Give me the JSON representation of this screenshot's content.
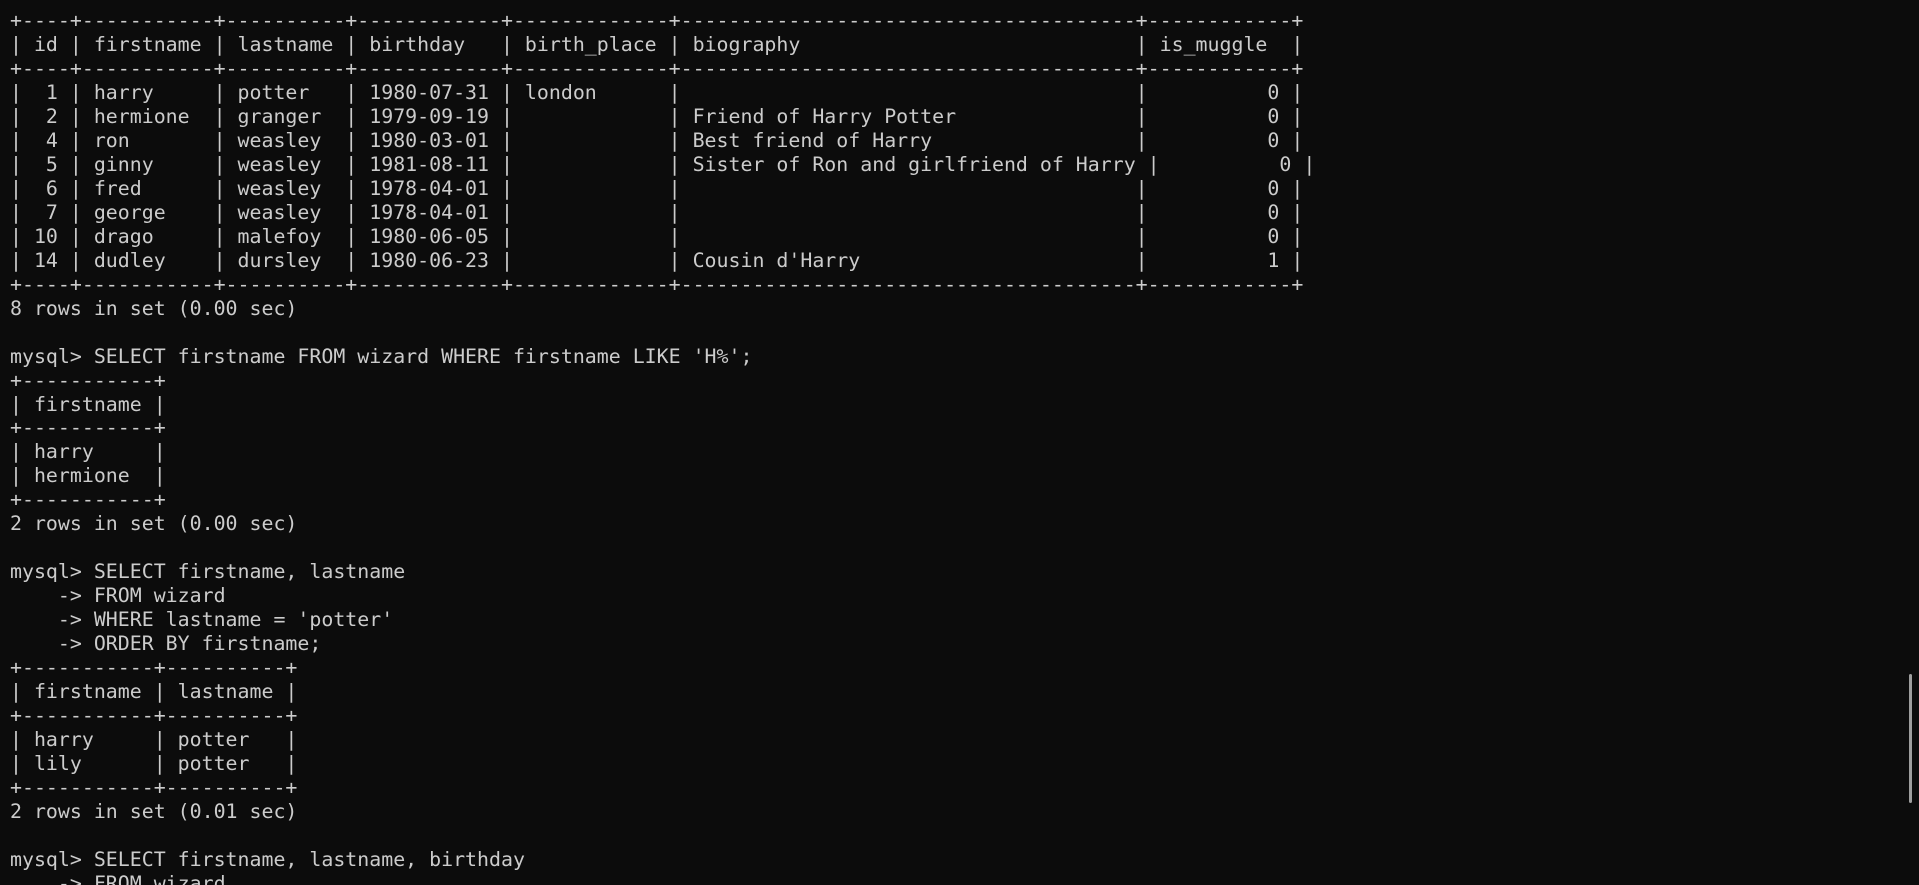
{
  "terminal": {
    "lines": [
      "+----+-----------+----------+------------+-------------+--------------------------------------+------------+",
      "| id | firstname | lastname | birthday   | birth_place | biography                            | is_muggle  |",
      "+----+-----------+----------+------------+-------------+--------------------------------------+------------+",
      "|  1 | harry     | potter   | 1980-07-31 | london      |                                      |          0 |",
      "|  2 | hermione  | granger  | 1979-09-19 |             | Friend of Harry Potter               |          0 |",
      "|  4 | ron       | weasley  | 1980-03-01 |             | Best friend of Harry                 |          0 |",
      "|  5 | ginny     | weasley  | 1981-08-11 |             | Sister of Ron and girlfriend of Harry |          0 |",
      "|  6 | fred      | weasley  | 1978-04-01 |             |                                      |          0 |",
      "|  7 | george    | weasley  | 1978-04-01 |             |                                      |          0 |",
      "| 10 | drago     | malefoy  | 1980-06-05 |             |                                      |          0 |",
      "| 14 | dudley    | dursley  | 1980-06-23 |             | Cousin d'Harry                       |          1 |",
      "+----+-----------+----------+------------+-------------+--------------------------------------+------------+",
      "8 rows in set (0.00 sec)",
      "",
      "mysql> SELECT firstname FROM wizard WHERE firstname LIKE 'H%';",
      "+-----------+",
      "| firstname |",
      "+-----------+",
      "| harry     |",
      "| hermione  |",
      "+-----------+",
      "2 rows in set (0.00 sec)",
      "",
      "mysql> SELECT firstname, lastname",
      "    -> FROM wizard",
      "    -> WHERE lastname = 'potter'",
      "    -> ORDER BY firstname;",
      "+-----------+----------+",
      "| firstname | lastname |",
      "+-----------+----------+",
      "| harry     | potter   |",
      "| lily      | potter   |",
      "+-----------+----------+",
      "2 rows in set (0.01 sec)",
      "",
      "mysql> SELECT firstname, lastname, birthday",
      "    -> FROM wizard"
    ]
  },
  "scrollbar": {
    "icon": "scrollbar-thumb"
  },
  "colors": {
    "background": "#0c0c0c",
    "foreground": "#cccccc",
    "scrollbar": "#9e9e9e"
  }
}
